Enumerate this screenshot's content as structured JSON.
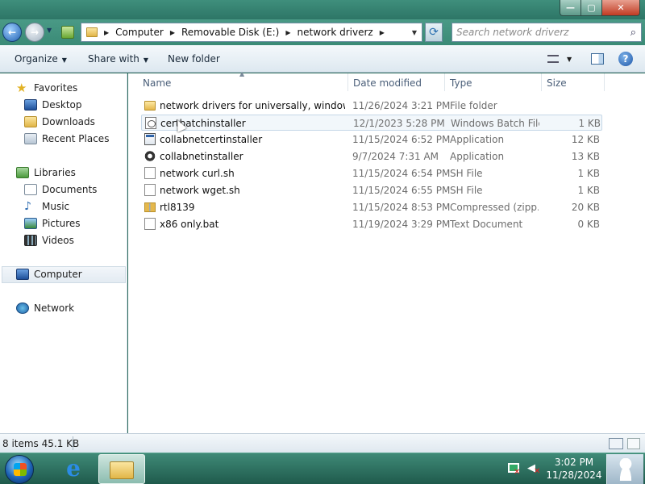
{
  "address": {
    "crumbs": [
      "Computer",
      "Removable Disk (E:)",
      "network driverz"
    ],
    "search_placeholder": "Search network driverz"
  },
  "toolbar": {
    "organize": "Organize",
    "share_with": "Share with",
    "new_folder": "New folder"
  },
  "nav": {
    "favorites": "Favorites",
    "desktop": "Desktop",
    "downloads": "Downloads",
    "recent_places": "Recent Places",
    "libraries": "Libraries",
    "documents": "Documents",
    "music": "Music",
    "pictures": "Pictures",
    "videos": "Videos",
    "computer": "Computer",
    "network": "Network"
  },
  "columns": {
    "name": "Name",
    "date": "Date modified",
    "type": "Type",
    "size": "Size"
  },
  "files": [
    {
      "name": "network drivers for universally, windows ...",
      "date": "11/26/2024 3:21 PM",
      "type": "File folder",
      "size": "",
      "icon": "folder-icon"
    },
    {
      "name": "certbatchinstaller",
      "date": "12/1/2023 5:28 PM",
      "type": "Windows Batch File",
      "size": "1 KB",
      "icon": "batch-file-icon"
    },
    {
      "name": "collabnetcertinstaller",
      "date": "11/15/2024 6:52 PM",
      "type": "Application",
      "size": "12 KB",
      "icon": "application-icon"
    },
    {
      "name": "collabnetinstaller",
      "date": "9/7/2024 7:31 AM",
      "type": "Application",
      "size": "13 KB",
      "icon": "gear-icon"
    },
    {
      "name": "network curl.sh",
      "date": "11/15/2024 6:54 PM",
      "type": "SH File",
      "size": "1 KB",
      "icon": "document-icon"
    },
    {
      "name": "network wget.sh",
      "date": "11/15/2024 6:55 PM",
      "type": "SH File",
      "size": "1 KB",
      "icon": "document-icon"
    },
    {
      "name": "rtl8139",
      "date": "11/15/2024 8:53 PM",
      "type": "Compressed (zipp...",
      "size": "20 KB",
      "icon": "zip-folder-icon"
    },
    {
      "name": "x86 only.bat",
      "date": "11/19/2024 3:29 PM",
      "type": "Text Document",
      "size": "0 KB",
      "icon": "document-icon"
    }
  ],
  "status": {
    "count": "8 items  45.1 KB"
  },
  "taskbar": {
    "time": "3:02 PM",
    "date": "11/28/2024"
  },
  "colors": {
    "accent": "#2a6a5a",
    "selection": "#c5d7e7"
  }
}
